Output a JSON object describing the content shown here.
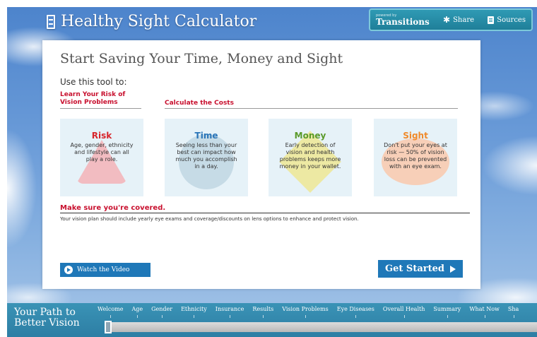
{
  "header": {
    "title": "Healthy Sight Calculator",
    "brand_small": "powered by",
    "brand_name": "Transitions",
    "share_label": "Share",
    "sources_label": "Sources"
  },
  "panel": {
    "title": "Start Saving Your Time, Money and Sight",
    "intro": "Use this tool to:",
    "risk_section_label": "Learn Your Risk of Vision Problems",
    "costs_section_label": "Calculate the Costs",
    "cards": [
      {
        "title": "Risk",
        "body": "Age, gender, ethnicity and lifestyle can all play a role.",
        "color": "#d7262c"
      },
      {
        "title": "Time",
        "body": "Seeing less than your best can impact how much you accomplish in a day.",
        "color": "#2a75b8"
      },
      {
        "title": "Money",
        "body": "Early detection of vision and health problems keeps more money in your wallet.",
        "color": "#5a9a2a"
      },
      {
        "title": "Sight",
        "body": "Don't put your eyes at risk — 50% of vision loss can be prevented with an eye exam.",
        "color": "#f08a2a"
      }
    ],
    "covered_title": "Make sure you're covered.",
    "covered_text": "Your vision plan should include yearly eye exams and coverage/discounts on lens options to enhance and protect vision.",
    "video_label": "Watch the Video",
    "start_label": "Get Started"
  },
  "footer": {
    "path_title_line1": "Your Path to",
    "path_title_line2": "Better Vision",
    "steps": [
      "Welcome",
      "Age",
      "Gender",
      "Ethnicity",
      "Insurance",
      "Results",
      "Vision Problems",
      "Eye Diseases",
      "Overall Health",
      "Summary",
      "What Now",
      "Sha"
    ]
  }
}
